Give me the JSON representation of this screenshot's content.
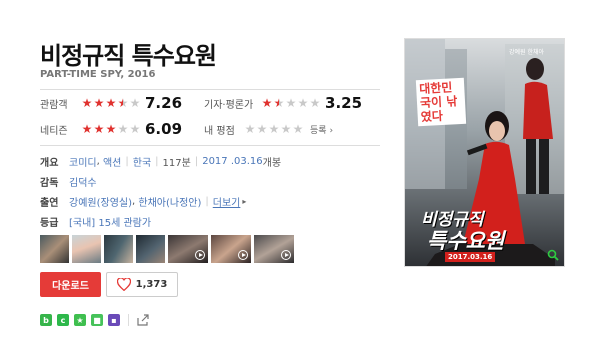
{
  "movie": {
    "title": "비정규직 특수요원",
    "subtitle": "PART-TIME SPY, 2016"
  },
  "ratings": {
    "audience": {
      "label": "관람객",
      "score": "7.26",
      "stars": 3.5
    },
    "critic": {
      "label": "기자·평론가",
      "score": "3.25",
      "stars": 1.5
    },
    "netizen": {
      "label": "네티즌",
      "score": "6.09",
      "stars": 3
    },
    "mine": {
      "label": "내 평점",
      "stars": 0,
      "link": "등록"
    }
  },
  "info": {
    "overview_label": "개요",
    "genres": [
      "코미디",
      "액션"
    ],
    "country": "한국",
    "runtime": "117분",
    "release_date": "2017 .03.16",
    "release_suffix": "개봉",
    "director_label": "감독",
    "director": "김덕수",
    "cast_label": "출연",
    "cast": [
      "강예원(장영실)",
      "한채아(나정안)"
    ],
    "cast_more": "더보기",
    "rating_label": "등급",
    "rating": "[국내] 15세 관람가"
  },
  "actions": {
    "download": "다운로드",
    "likes": "1,373"
  },
  "poster": {
    "tagline": "대한민국이 낚였다",
    "title_line1": "비정규직",
    "title_line2": "특수요원",
    "date": "2017.03.16",
    "credits": "강예원 한채아"
  },
  "colors": {
    "accent_red": "#e53b38",
    "star_on": "#e0322f",
    "star_off": "#c9c9c9",
    "link_blue": "#4a76b8"
  }
}
